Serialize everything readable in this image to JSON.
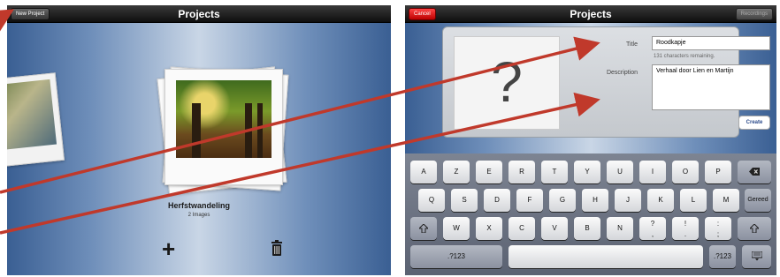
{
  "left_screen": {
    "navbar": {
      "title": "Projects",
      "new_project_label": "New Project"
    },
    "project": {
      "name": "Herfstwandeling",
      "count": "2 Images"
    },
    "toolbar": {
      "add_glyph": "+",
      "delete_icon": "trash-icon"
    }
  },
  "right_screen": {
    "navbar": {
      "title": "Projects",
      "cancel_label": "Cancel",
      "recordings_label": "Recordings"
    },
    "form": {
      "title_label": "Title",
      "title_value": "Roodkapje",
      "chars_remaining": "131 characters remaining.",
      "description_label": "Description",
      "description_value": "Verhaal door Lien en Martijn",
      "create_label": "Create",
      "placeholder_glyph": "?"
    },
    "keyboard": {
      "row1": [
        "A",
        "Z",
        "E",
        "R",
        "T",
        "Y",
        "U",
        "I",
        "O",
        "P"
      ],
      "row2": [
        "Q",
        "S",
        "D",
        "F",
        "G",
        "H",
        "J",
        "K",
        "L",
        "M"
      ],
      "row2_return": "Gereed",
      "row3": [
        "W",
        "X",
        "C",
        "V",
        "B",
        "N",
        "?",
        ",",
        "!",
        ".",
        ":",
        ";"
      ],
      "row4_left": ".?123",
      "row4_right": ".?123"
    }
  },
  "colors": {
    "arrow": "#c0392b",
    "cancel": "#d11",
    "navbar": "#1a1a1a"
  }
}
